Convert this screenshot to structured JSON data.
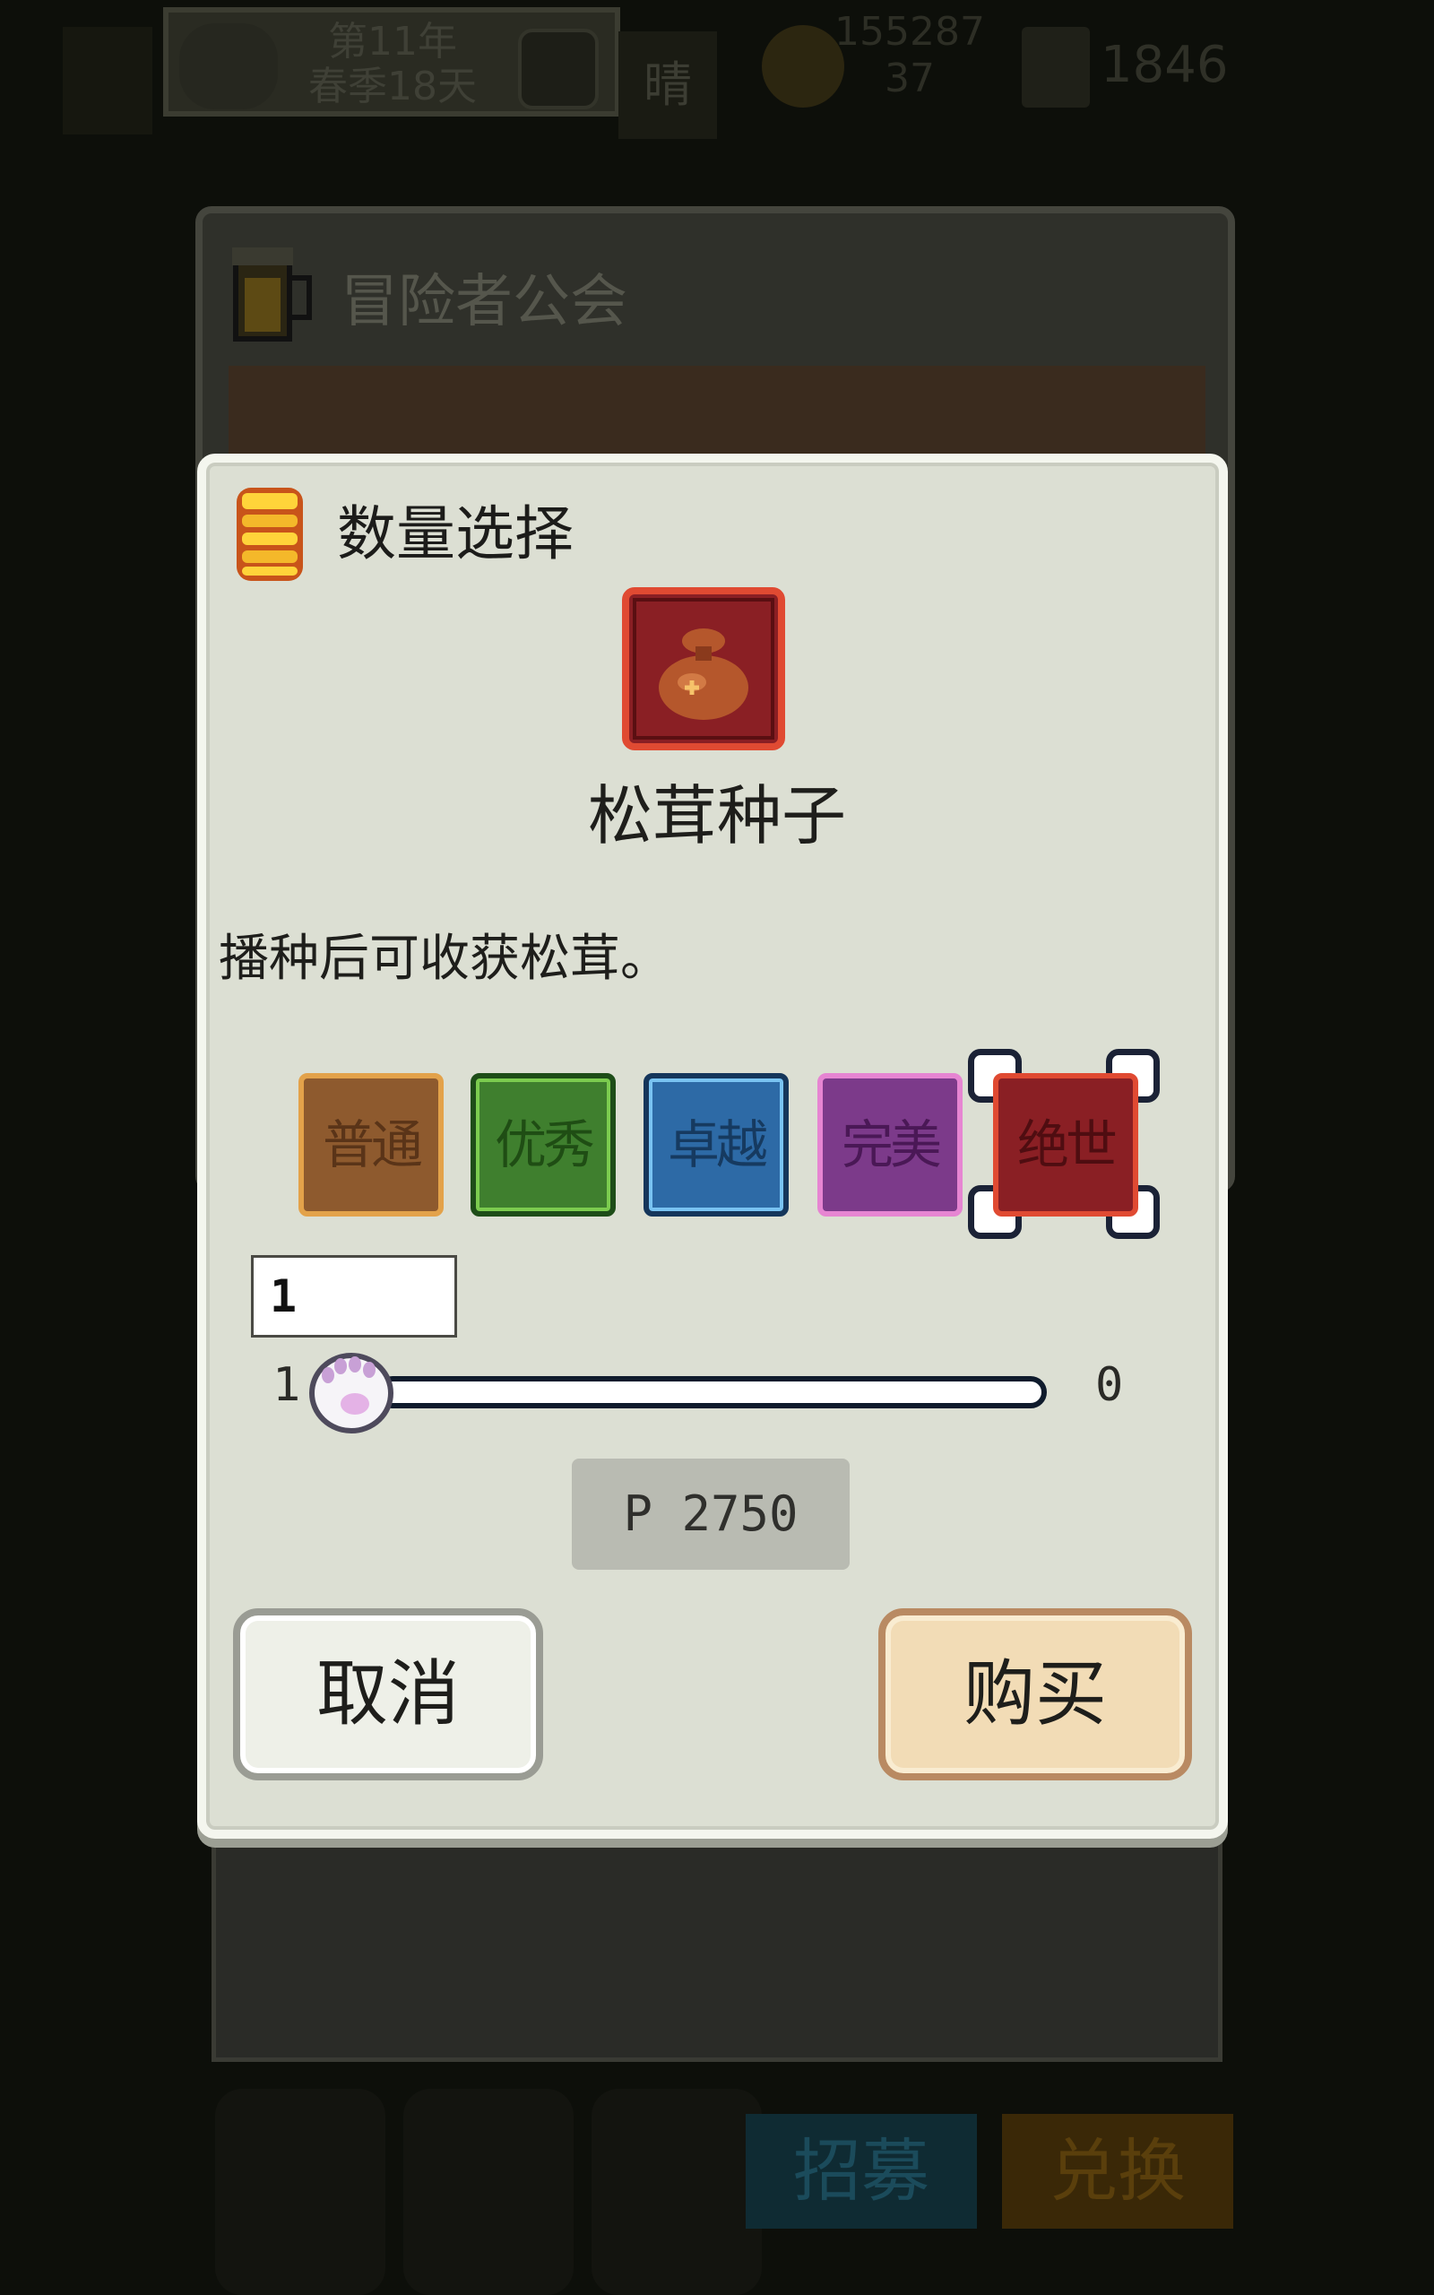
{
  "background": {
    "date_line1": "第11年",
    "date_line2": "春季18天",
    "weather": "晴",
    "money_line1": "155287",
    "money_line2": "37",
    "card_count": "1846",
    "guild_title": "冒险者公会",
    "nav_recruit": "招募",
    "nav_exchange": "兑换"
  },
  "dialog": {
    "title": "数量选择",
    "item_name": "松茸种子",
    "item_description": "播种后可收获松茸。",
    "grades": [
      {
        "label": "普通",
        "color": "#8e5a2e",
        "selected": false
      },
      {
        "label": "优秀",
        "color": "#3f7f2e",
        "selected": false
      },
      {
        "label": "卓越",
        "color": "#2d6aa6",
        "selected": false
      },
      {
        "label": "完美",
        "color": "#7c3a8a",
        "selected": false
      },
      {
        "label": "绝世",
        "color": "#8a1f24",
        "selected": true
      }
    ],
    "quantity_value": "1",
    "slider": {
      "min": "1",
      "max": "0",
      "value": 1
    },
    "price": "P 2750",
    "cancel_label": "取消",
    "buy_label": "购买"
  }
}
